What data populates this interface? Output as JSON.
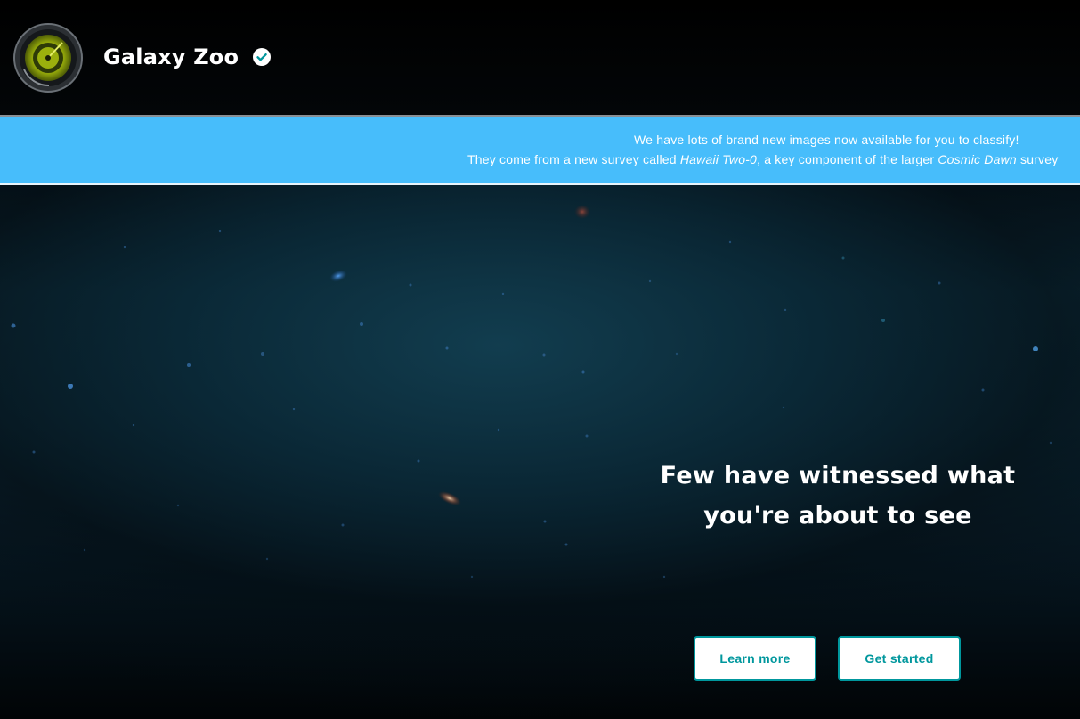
{
  "header": {
    "project_title": "Galaxy Zoo",
    "logo_icon": "galaxy-zoo-logo",
    "verified_icon": "verified-check-icon"
  },
  "announcement": {
    "line1": "We have lots of brand new images now available for you to classify!",
    "line2_prefix": "They come from a new survey called ",
    "line2_survey": "Hawaii Two-0",
    "line2_middle": ", a key component of the larger ",
    "line2_parent": "Cosmic Dawn",
    "line2_suffix": " survey",
    "background_color": "#47bdfb"
  },
  "hero": {
    "heading": "Few have witnessed what you're about to see",
    "learn_more_label": "Learn more",
    "get_started_label": "Get started",
    "accent_color": "#00979d"
  }
}
